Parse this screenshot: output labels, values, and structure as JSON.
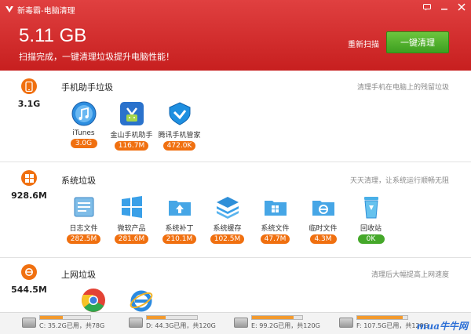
{
  "app": {
    "title": "新毒霸-电脑清理"
  },
  "header": {
    "size": "5.11 GB",
    "subtitle": "扫描完成，一键清理垃圾提升电脑性能！",
    "rescan": "重新扫描",
    "clean_btn": "一键清理"
  },
  "sections": [
    {
      "size": "3.1G",
      "title": "手机助手垃圾",
      "desc": "清理手机在电脑上的残留垃圾",
      "items": [
        {
          "name": "iTunes",
          "size": "3.0G"
        },
        {
          "name": "金山手机助手",
          "size": "116.7M"
        },
        {
          "name": "腾讯手机管家",
          "size": "472.0K"
        }
      ]
    },
    {
      "size": "928.6M",
      "title": "系统垃圾",
      "desc": "天天清理，让系统运行顺畅无阻",
      "items": [
        {
          "name": "日志文件",
          "size": "282.5M"
        },
        {
          "name": "微软产品",
          "size": "281.6M"
        },
        {
          "name": "系统补丁",
          "size": "210.1M"
        },
        {
          "name": "系统缓存",
          "size": "102.5M"
        },
        {
          "name": "系统文件",
          "size": "47.7M"
        },
        {
          "name": "临时文件",
          "size": "4.3M"
        },
        {
          "name": "回收站",
          "size": "0K"
        }
      ]
    },
    {
      "size": "544.5M",
      "title": "上网垃圾",
      "desc": "清理后大幅提高上网速度",
      "items": []
    }
  ],
  "drives": [
    {
      "text": "C: 35.2G已用，共78G",
      "used_fraction": 0.45
    },
    {
      "text": "D: 44.3G已用，共120G",
      "used_fraction": 0.37
    },
    {
      "text": "E: 99.2G已用，共120G",
      "used_fraction": 0.83
    },
    {
      "text": "F: 107.5G已用，共120G",
      "used_fraction": 0.9
    }
  ],
  "watermark": "mua牛牛网",
  "colors": {
    "header": "#d42b2b",
    "accent": "#f07010",
    "clean_btn": "#4caf30",
    "badge_zero": "#45a82a"
  }
}
